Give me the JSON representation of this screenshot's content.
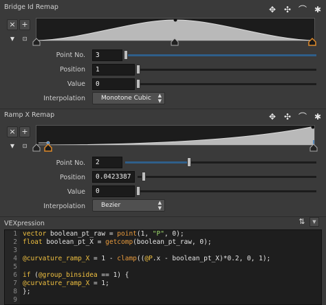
{
  "bridge_ramp": {
    "title": "Bridge Id Remap",
    "params": {
      "point_label": "Point No.",
      "point_value": "3",
      "position_label": "Position",
      "position_value": "1",
      "value_label": "Value",
      "value_value": "0",
      "interp_label": "Interpolation",
      "interp_value": "Monotone Cubic"
    }
  },
  "x_ramp": {
    "title": "Ramp X Remap",
    "params": {
      "point_label": "Point No.",
      "point_value": "2",
      "position_label": "Position",
      "position_value": "0.0423387",
      "value_label": "Value",
      "value_value": "0",
      "interp_label": "Interpolation",
      "interp_value": "Bezier"
    }
  },
  "buttons": {
    "remove": "×",
    "add": "+"
  },
  "vex": {
    "title": "VEXpression",
    "line_numbers": [
      "1",
      "2",
      "3",
      "4",
      "5",
      "6",
      "7",
      "8",
      "9"
    ],
    "lines": [
      [
        {
          "t": "vector ",
          "c": "kw"
        },
        {
          "t": "boolean_pt_raw = ",
          "c": ""
        },
        {
          "t": "point",
          "c": "fn"
        },
        {
          "t": "(1, ",
          "c": ""
        },
        {
          "t": "\"P\"",
          "c": "str"
        },
        {
          "t": ", 0);",
          "c": ""
        }
      ],
      [
        {
          "t": "float ",
          "c": "kw"
        },
        {
          "t": "boolean_pt_X = ",
          "c": ""
        },
        {
          "t": "getcomp",
          "c": "fn"
        },
        {
          "t": "(boolean_pt_raw, 0);",
          "c": ""
        }
      ],
      [
        {
          "t": "",
          "c": ""
        }
      ],
      [
        {
          "t": "@curvature_ramp_X",
          "c": "attr"
        },
        {
          "t": " = 1 - ",
          "c": ""
        },
        {
          "t": "clamp",
          "c": "fn"
        },
        {
          "t": "((",
          "c": ""
        },
        {
          "t": "@P",
          "c": "attr"
        },
        {
          "t": ".x - boolean_pt_X)*0.2, 0, 1);",
          "c": ""
        }
      ],
      [
        {
          "t": "",
          "c": ""
        }
      ],
      [
        {
          "t": "if ",
          "c": "kw"
        },
        {
          "t": "(",
          "c": ""
        },
        {
          "t": "@group_binsidea",
          "c": "attr"
        },
        {
          "t": " == 1) {",
          "c": ""
        }
      ],
      [
        {
          "t": "@curvature_ramp_X",
          "c": "attr"
        },
        {
          "t": " = 1;",
          "c": ""
        }
      ],
      [
        {
          "t": "};",
          "c": ""
        }
      ],
      [
        {
          "t": "",
          "c": ""
        }
      ]
    ]
  }
}
